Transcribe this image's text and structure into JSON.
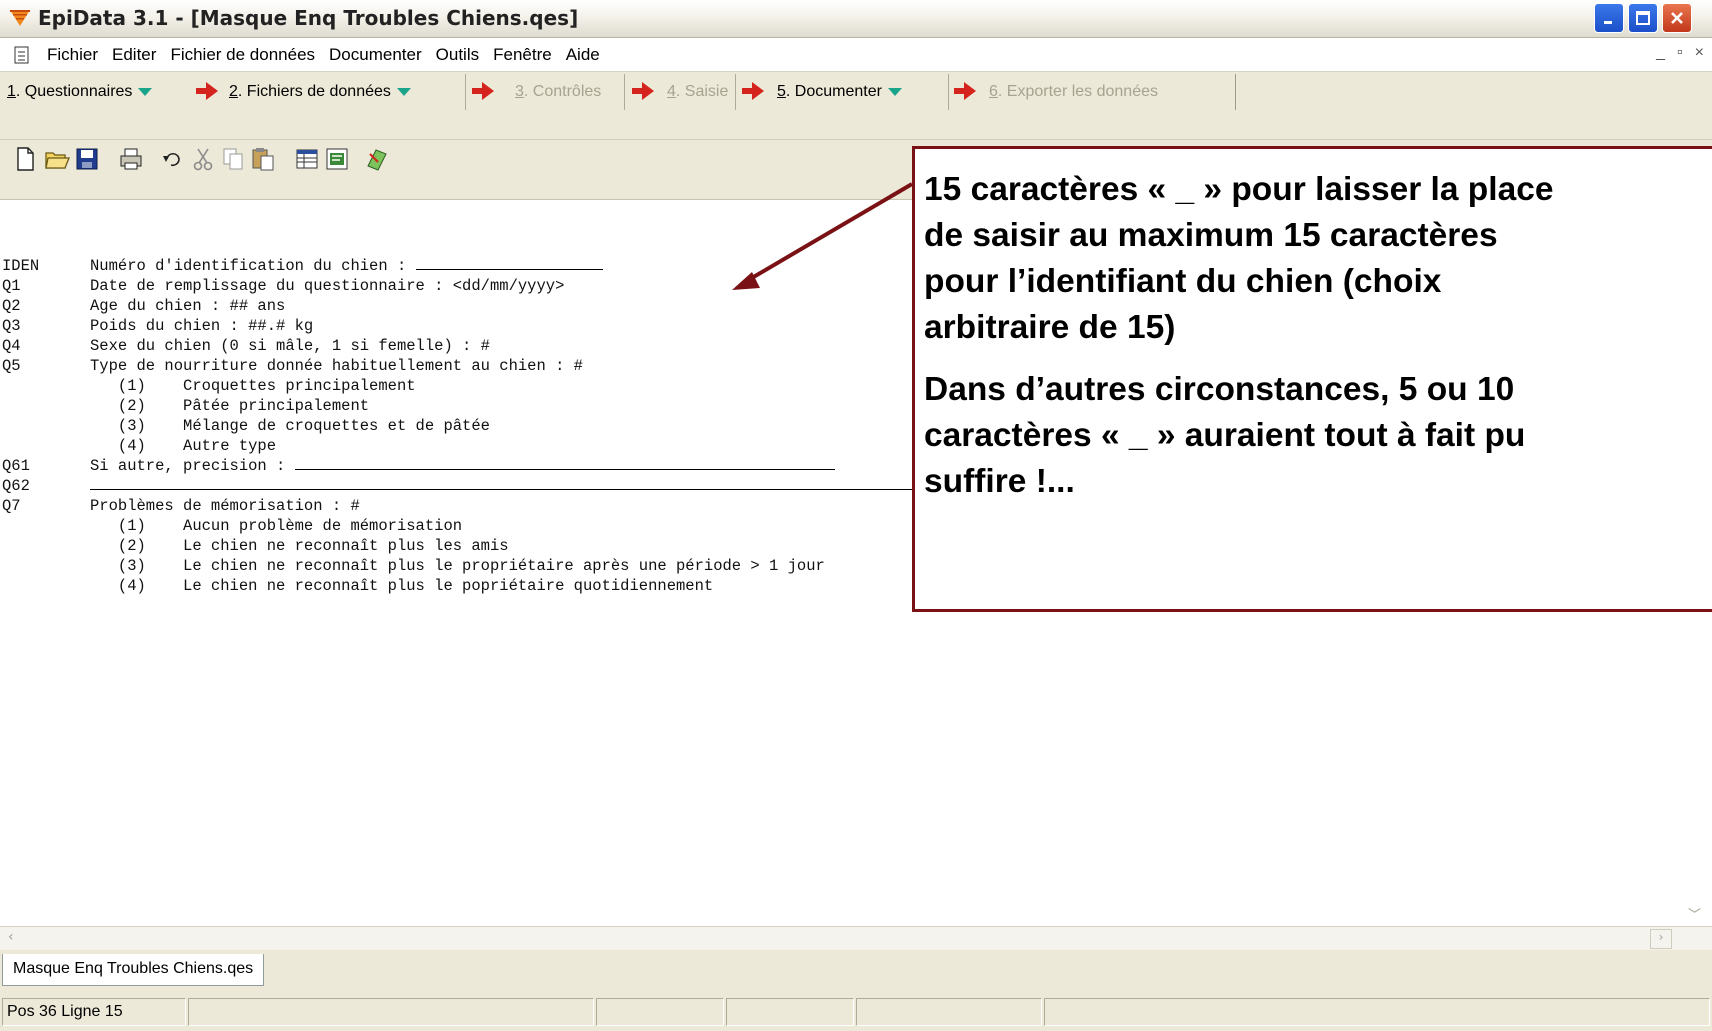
{
  "window": {
    "title": "EpiData 3.1 - [Masque Enq Troubles Chiens.qes]"
  },
  "menu": {
    "items": [
      "Fichier",
      "Editer",
      "Fichier de données",
      "Documenter",
      "Outils",
      "Fenêtre",
      "Aide"
    ]
  },
  "workflow": {
    "steps": [
      {
        "num": "1",
        "label": ". Questionnaires",
        "enabled": true,
        "dropdown": true
      },
      {
        "num": "2",
        "label": ". Fichiers de données",
        "enabled": true,
        "dropdown": true
      },
      {
        "num": "3",
        "label": ". Contrôles",
        "enabled": false,
        "dropdown": false
      },
      {
        "num": "4",
        "label": ". Saisie",
        "enabled": false,
        "dropdown": false
      },
      {
        "num": "5",
        "label": ". Documenter",
        "enabled": true,
        "dropdown": true
      },
      {
        "num": "6",
        "label": ". Exporter les données",
        "enabled": false,
        "dropdown": false
      }
    ]
  },
  "toolbar": {
    "icons": [
      "new-file-icon",
      "open-folder-icon",
      "save-icon",
      "print-icon",
      "undo-icon",
      "cut-icon",
      "copy-icon",
      "paste-icon",
      "field-list-icon",
      "codebook-icon",
      "preview-icon"
    ]
  },
  "editor": {
    "lines": [
      {
        "code": "IDEN",
        "text": "Numéro d'identification du chien : ",
        "blank_chars": 15
      },
      {
        "code": "Q1",
        "text": "Date de remplissage du questionnaire : <dd/mm/yyyy>"
      },
      {
        "code": "Q2",
        "text": "Age du chien : ## ans"
      },
      {
        "code": "Q3",
        "text": "Poids du chien : ##.# kg"
      },
      {
        "code": "Q4",
        "text": "Sexe du chien (0 si mâle, 1 si femelle) : #"
      },
      {
        "code": "Q5",
        "text": "Type de nourriture donnée habituellement au chien : #"
      },
      {
        "code": "",
        "text": "   (1)    Croquettes principalement"
      },
      {
        "code": "",
        "text": "   (2)    Pâtée principalement"
      },
      {
        "code": "",
        "text": "   (3)    Mélange de croquettes et de pâtée"
      },
      {
        "code": "",
        "text": "   (4)    Autre type"
      },
      {
        "code": "Q61",
        "text": "Si autre, precision : ",
        "blank_chars": 60
      },
      {
        "code": "Q62",
        "text": "",
        "blank_chars": 82
      },
      {
        "code": "Q7",
        "text": "Problèmes de mémorisation : #"
      },
      {
        "code": "",
        "text": "   (1)    Aucun problème de mémorisation"
      },
      {
        "code": "",
        "text": "   (2)    Le chien ne reconnaît plus les amis"
      },
      {
        "code": "",
        "text": "   (3)    Le chien ne reconnaît plus le propriétaire après une période > 1 jour"
      },
      {
        "code": "",
        "text": "   (4)    Le chien ne reconnaît plus le popriétaire quotidiennement"
      }
    ]
  },
  "tab": {
    "label": "Masque Enq Troubles Chiens.qes"
  },
  "status": {
    "position": "Pos 36  Ligne 15"
  },
  "callout": {
    "paragraph1": [
      "15 caractères « _ » pour laisser la place",
      "de saisir au maximum 15 caractères",
      "pour l’identifiant du chien (choix",
      "arbitraire de 15)"
    ],
    "paragraph2": [
      "Dans d’autres circonstances, 5 ou 10",
      "caractères « _ » auraient tout à fait pu",
      "suffire !..."
    ],
    "border_color": "#7a1215"
  }
}
